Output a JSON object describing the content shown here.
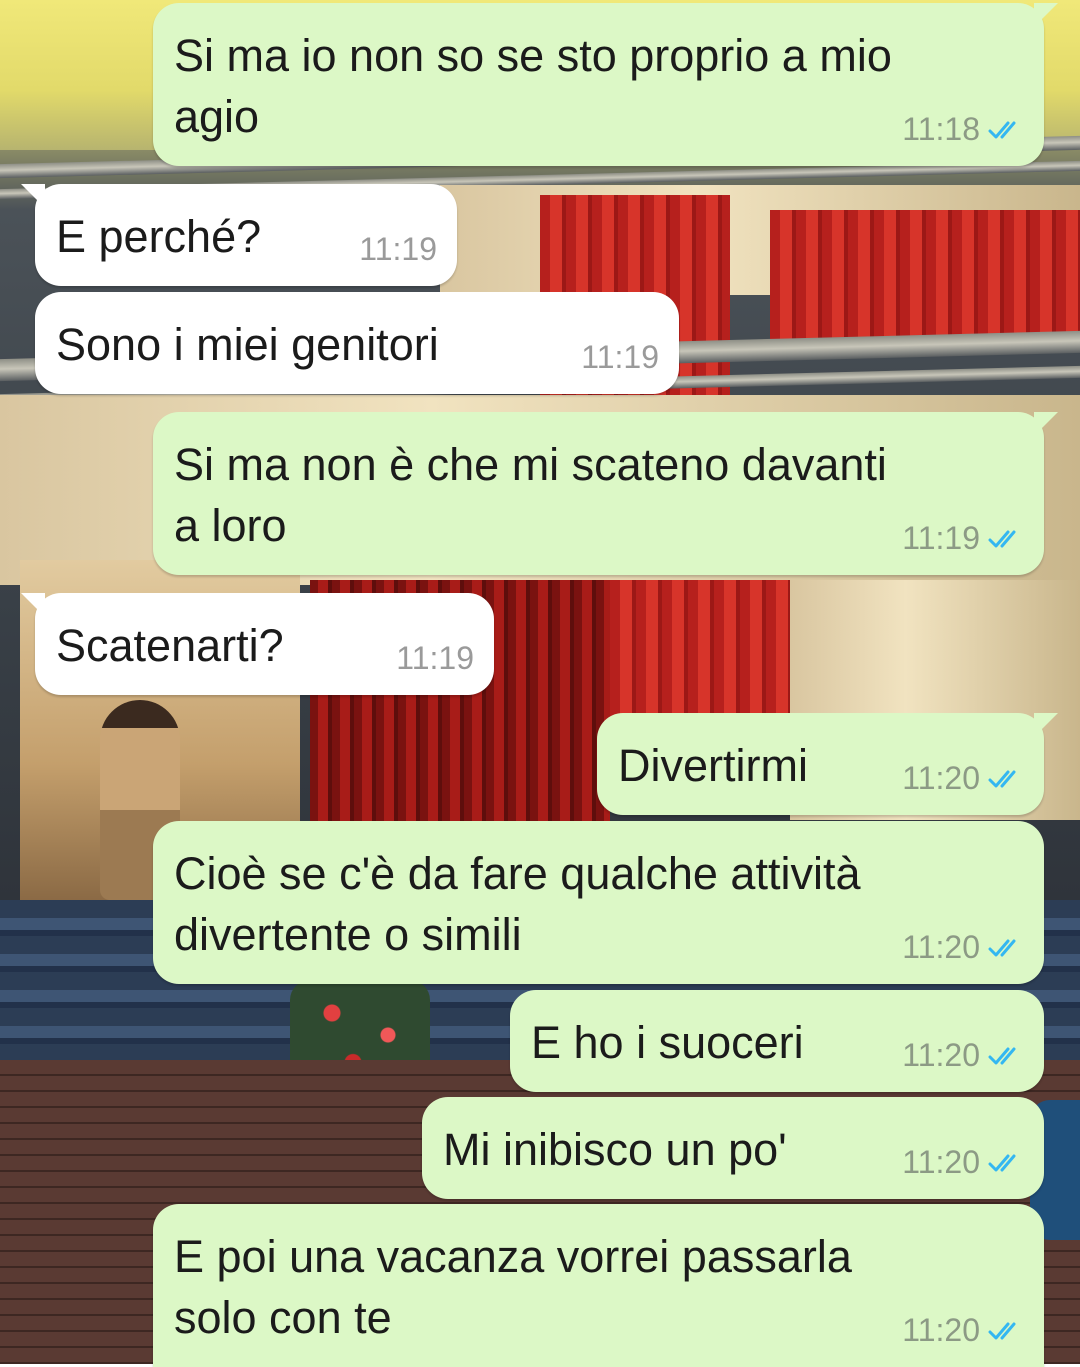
{
  "colors": {
    "outgoing_bubble": "#dcf8c6",
    "incoming_bubble": "#ffffff",
    "read_ticks": "#34b7f1",
    "timestamp": "#8c9a85"
  },
  "messages": [
    {
      "direction": "out",
      "text": "Si ma io non so se sto proprio a mio agio",
      "time": "11:18",
      "status": "read-double-tick-icon"
    },
    {
      "direction": "in",
      "text": "E perché?",
      "time": "11:19"
    },
    {
      "direction": "in",
      "text": "Sono i miei genitori",
      "time": "11:19"
    },
    {
      "direction": "out",
      "text": "Si ma non è che mi scateno davanti a loro",
      "time": "11:19",
      "status": "read-double-tick-icon"
    },
    {
      "direction": "in",
      "text": "Scatenarti?",
      "time": "11:19"
    },
    {
      "direction": "out",
      "text": "Divertirmi",
      "time": "11:20",
      "status": "read-double-tick-icon"
    },
    {
      "direction": "out",
      "text": "Cioè se c'è da fare qualche attività divertente o simili",
      "time": "11:20",
      "status": "read-double-tick-icon"
    },
    {
      "direction": "out",
      "text": "E ho i suoceri",
      "time": "11:20",
      "status": "read-double-tick-icon"
    },
    {
      "direction": "out",
      "text": "Mi inibisco un po'",
      "time": "11:20",
      "status": "read-double-tick-icon"
    },
    {
      "direction": "out",
      "text": "E poi una vacanza vorrei passarla solo con te",
      "time": "11:20",
      "status": "read-double-tick-icon"
    }
  ]
}
